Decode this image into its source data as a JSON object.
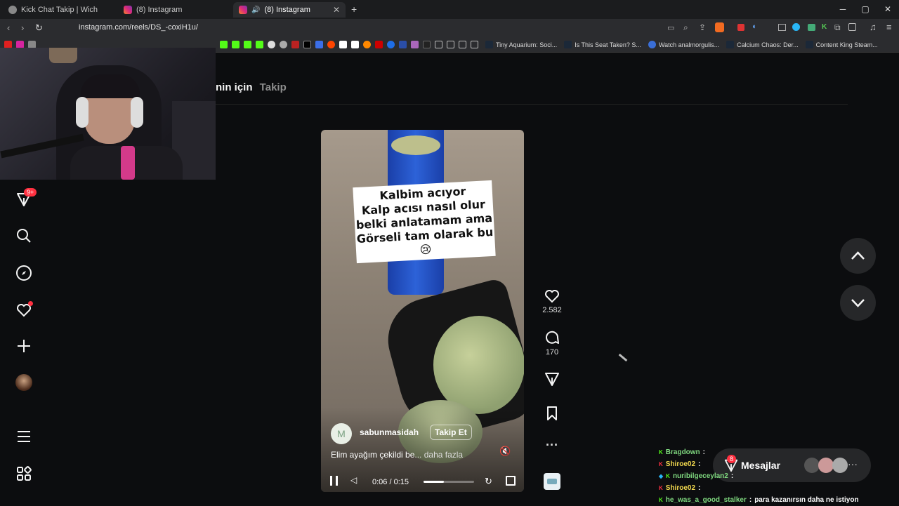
{
  "tabs": [
    {
      "title": "Kick Chat Takip | Wich"
    },
    {
      "title": "(8) Instagram"
    },
    {
      "title": "(8) Instagram"
    }
  ],
  "url": "instagram.com/reels/DS_-coxiH1u/",
  "bookmarks": [
    {
      "label": "Tiny Aquarium: Soci..."
    },
    {
      "label": "Is This Seat Taken? S..."
    },
    {
      "label": "Watch analmorgulis..."
    },
    {
      "label": "Calcium Chaos: Der..."
    },
    {
      "label": "Content King Steam..."
    }
  ],
  "ig": {
    "tab_for_you": "nin için",
    "tab_following": "Takip",
    "notif_badge": "9+",
    "caption_lines": [
      "Kalbim acıyor",
      "Kalp acısı nasıl olur",
      "belki anlatamam ama",
      "Görseli tam olarak bu",
      "😢"
    ],
    "likes": "2.582",
    "comments": "170",
    "username": "sabunmasidah",
    "follow_label": "Takip Et",
    "description": "Elim ayağım çekildi be",
    "more": "... daha fazla",
    "time": "0:06 / 0:15",
    "progress": 0.4,
    "messages_label": "Mesajlar",
    "messages_badge": "8"
  },
  "chat": [
    {
      "user": "Bragdown",
      "msg": "",
      "color": "#7fd87f"
    },
    {
      "user": "Shiroe02",
      "msg": "",
      "color": "#f2d94e"
    },
    {
      "user": "nuribilgeceylan2",
      "msg": "",
      "color": "#7fd87f"
    },
    {
      "user": "Shiroe02",
      "msg": "",
      "color": "#f2d94e"
    },
    {
      "user": "he_was_a_good_stalker",
      "msg": "para kazanırsın daha ne istiyon",
      "color": "#7fd87f"
    }
  ]
}
